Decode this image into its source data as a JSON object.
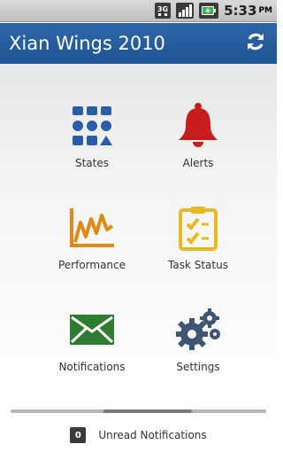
{
  "status_bar": {
    "network_label": "3G",
    "time": "5:33",
    "ampm": "PM",
    "icons": [
      "network-3g-icon",
      "signal-icon",
      "battery-charging-icon"
    ]
  },
  "app_bar": {
    "title": "Xian Wings 2010",
    "refresh_icon": "refresh-icon"
  },
  "tiles": [
    {
      "label": "States",
      "icon": "states-grid-icon",
      "color": "#2a5ea7"
    },
    {
      "label": "Alerts",
      "icon": "bell-icon",
      "color": "#c71d1d"
    },
    {
      "label": "Performance",
      "icon": "performance-chart-icon",
      "color": "#e08a14"
    },
    {
      "label": "Task Status",
      "icon": "clipboard-check-icon",
      "color": "#e8b820"
    },
    {
      "label": "Notifications",
      "icon": "envelope-icon",
      "color": "#2f7d32"
    },
    {
      "label": "Settings",
      "icon": "gears-icon",
      "color": "#3e5674"
    }
  ],
  "footer": {
    "count": "0",
    "label": "Unread Notifications"
  }
}
